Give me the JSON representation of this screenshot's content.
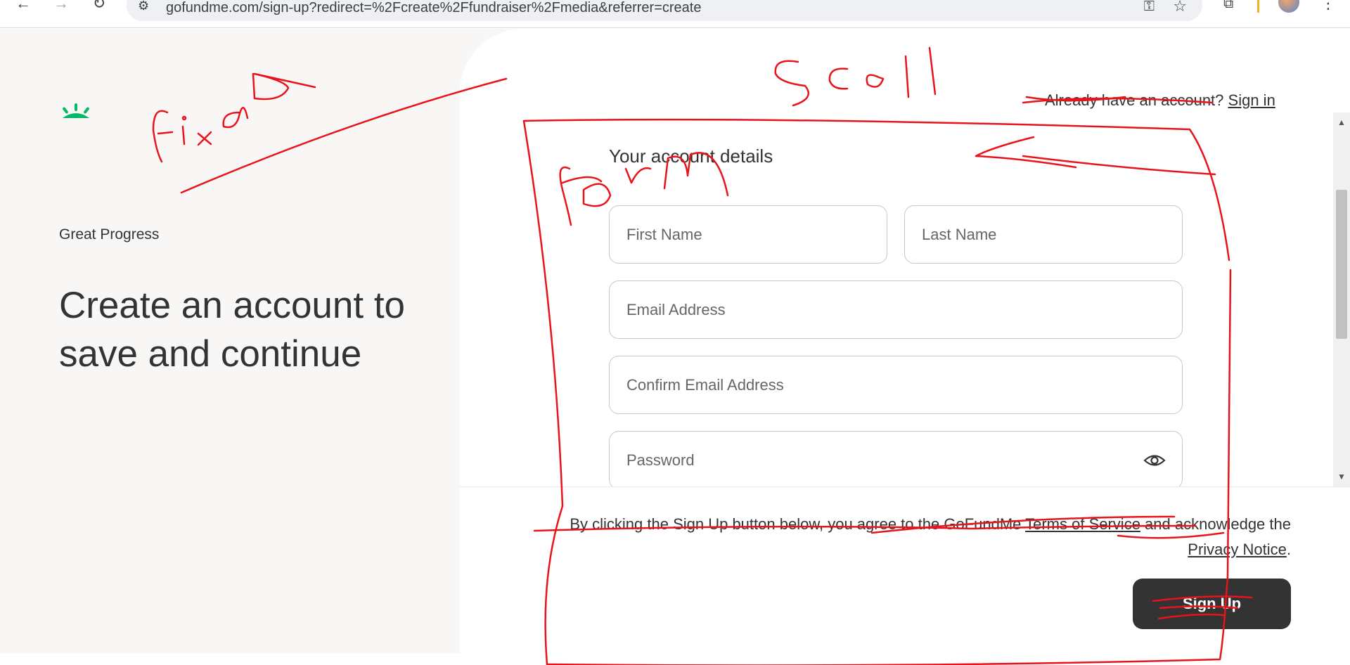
{
  "browser": {
    "url": "gofundme.com/sign-up?redirect=%2Fcreate%2Ffundraiser%2Fmedia&referrer=create",
    "back_icon": "←",
    "forward_icon": "→",
    "reload_icon": "↻"
  },
  "left": {
    "progress_label": "Great Progress",
    "headline": "Create an account to save and continue"
  },
  "header": {
    "signin_prompt": "Already have an account?",
    "signin_link": "Sign in"
  },
  "form": {
    "section_title": "Your account details",
    "first_name_placeholder": "First Name",
    "last_name_placeholder": "Last Name",
    "email_placeholder": "Email Address",
    "confirm_email_placeholder": "Confirm Email Address",
    "password_placeholder": "Password"
  },
  "footer": {
    "terms_prefix": "By clicking the Sign Up button below, you agree to the GoFundMe ",
    "terms_link": "Terms of Service",
    "terms_mid": " and acknowledge the ",
    "privacy_link": "Privacy Notice",
    "terms_suffix": ".",
    "signup_label": "Sign Up"
  },
  "annotations": {
    "fixed": "fixed",
    "scroll": "Scroll",
    "form": "Form"
  },
  "colors": {
    "brand_green": "#00b964",
    "annotation_red": "#e8141c",
    "button_dark": "#333333"
  }
}
